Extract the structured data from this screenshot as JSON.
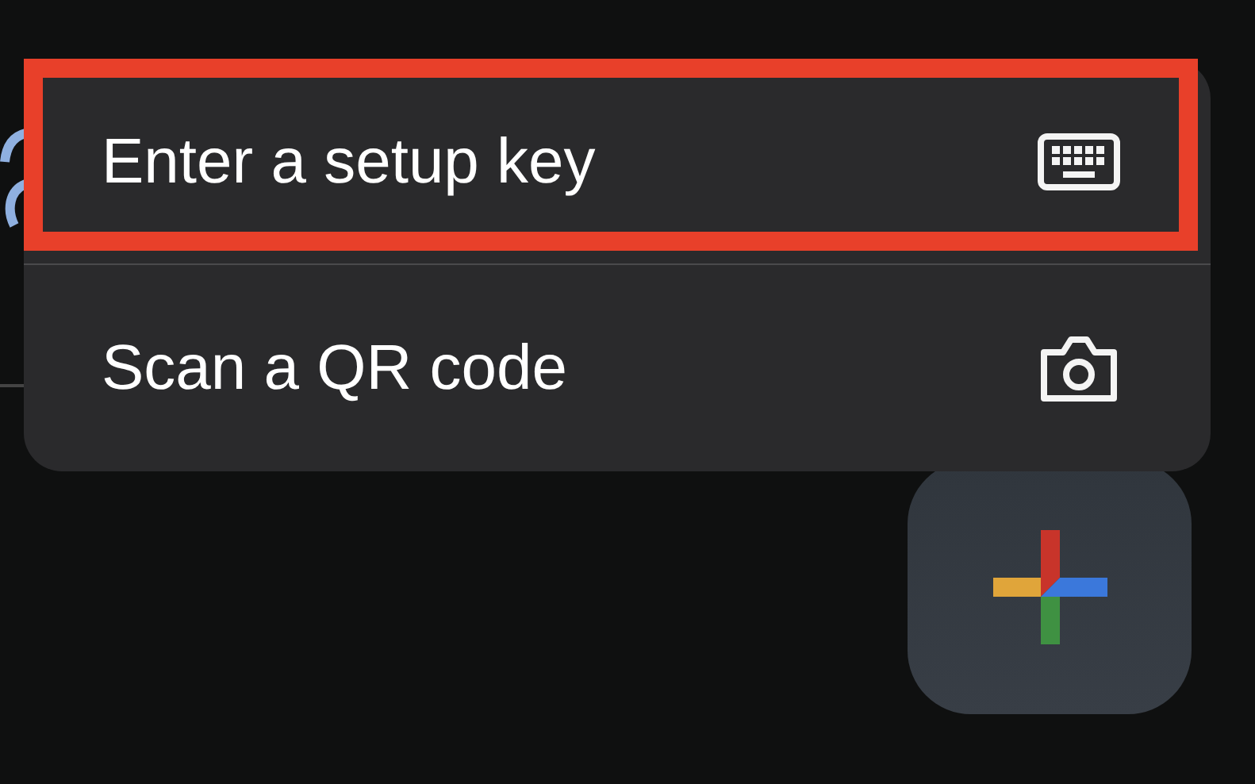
{
  "menu": {
    "items": [
      {
        "label": "Enter a setup key",
        "kind": "keyboard",
        "highlighted": true
      },
      {
        "label": "Scan a QR code",
        "kind": "camera",
        "highlighted": false
      }
    ]
  },
  "fab": {
    "kind": "add"
  }
}
